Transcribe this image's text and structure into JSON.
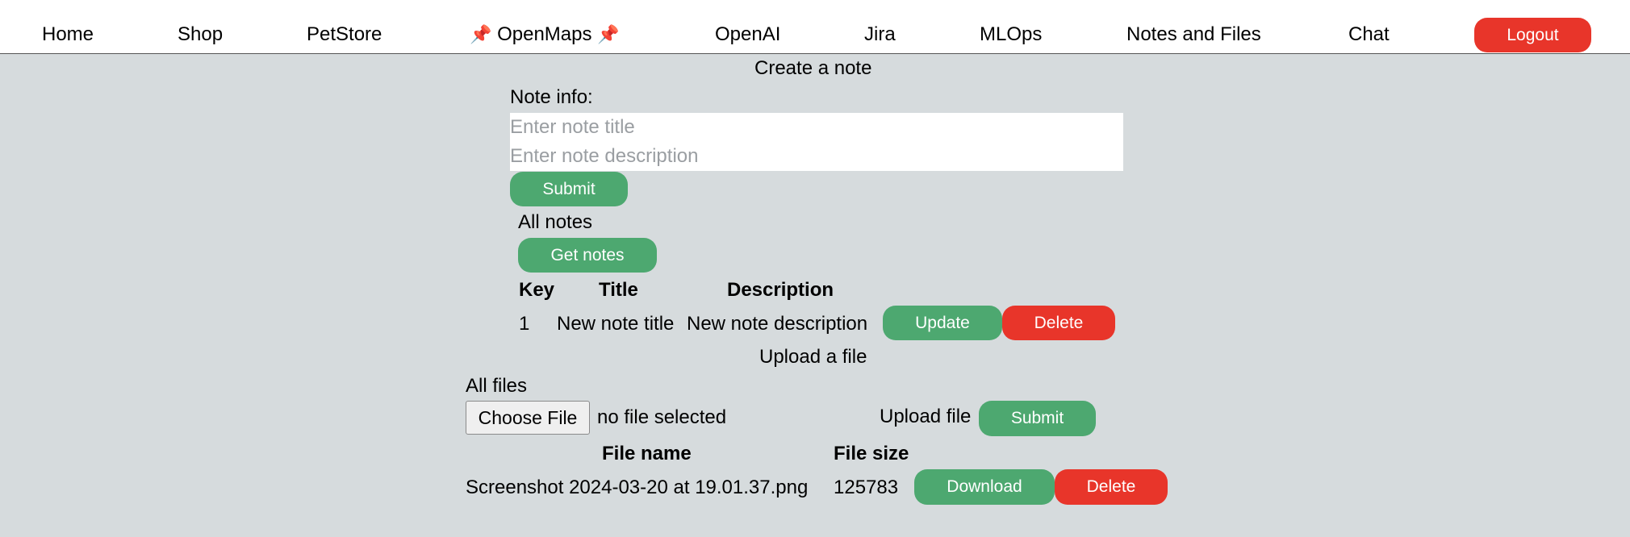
{
  "nav": {
    "items": [
      "Home",
      "Shop",
      "PetStore",
      "OpenMaps",
      "OpenAI",
      "Jira",
      "MLOps",
      "Notes and Files",
      "Chat"
    ],
    "pin_glyph": "📌",
    "logout_label": "Logout"
  },
  "notes": {
    "create_heading": "Create a note",
    "info_label": "Note info:",
    "title_placeholder": "Enter note title",
    "description_placeholder": "Enter note description",
    "submit_label": "Submit",
    "all_heading": "All notes",
    "get_label": "Get notes",
    "columns": [
      "Key",
      "Title",
      "Description"
    ],
    "rows": [
      {
        "key": "1",
        "title": "New note title",
        "description": "New note description",
        "update_label": "Update",
        "delete_label": "Delete"
      }
    ]
  },
  "files": {
    "upload_heading": "Upload a file",
    "all_heading": "All files",
    "choose_label": "Choose File",
    "no_file_text": "no file selected",
    "upload_label": "Upload file",
    "submit_label": "Submit",
    "columns": [
      "File name",
      "File size"
    ],
    "rows": [
      {
        "name": "Screenshot 2024-03-20 at 19.01.37.png",
        "size": "125783",
        "download_label": "Download",
        "delete_label": "Delete"
      }
    ]
  },
  "colors": {
    "green": "#4da870",
    "red": "#e8352a",
    "background": "#d6dbdd"
  }
}
